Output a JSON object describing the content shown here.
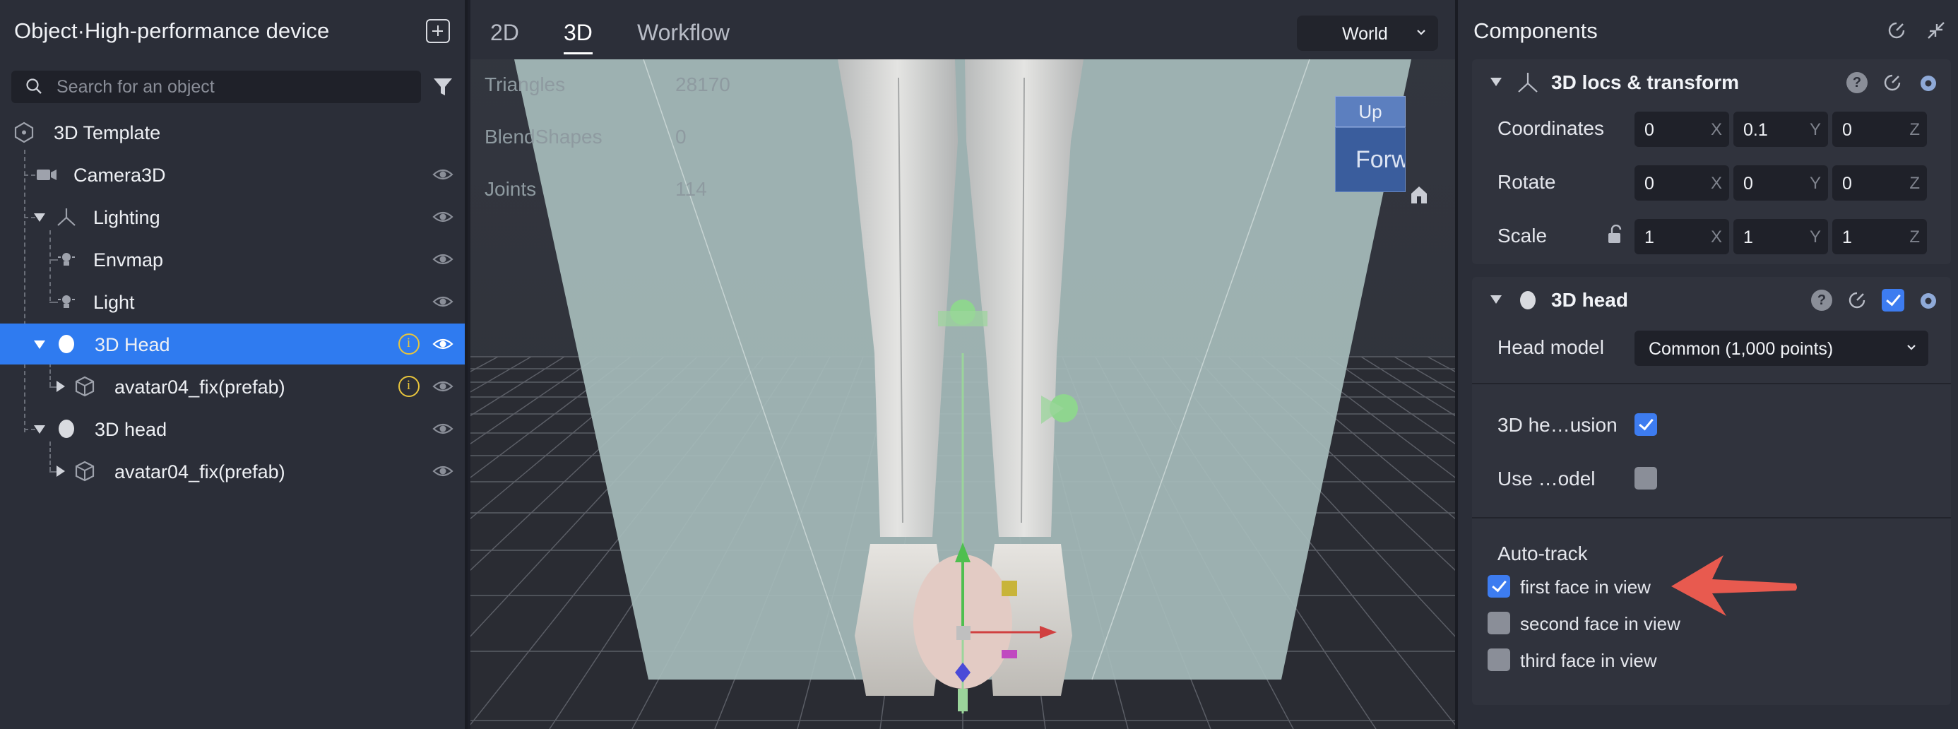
{
  "left_panel": {
    "title": "Object·High-performance device",
    "search_placeholder": "Search for an object",
    "tree": [
      {
        "label": "3D Template"
      },
      {
        "label": "Camera3D"
      },
      {
        "label": "Lighting"
      },
      {
        "label": "Envmap"
      },
      {
        "label": "Light"
      },
      {
        "label": "3D Head"
      },
      {
        "label": "avatar04_fix(prefab)"
      },
      {
        "label": "3D head"
      },
      {
        "label": "avatar04_fix(prefab)"
      }
    ]
  },
  "viewport": {
    "tabs": [
      "2D",
      "3D",
      "Workflow"
    ],
    "active_tab": "3D",
    "space_mode": "World",
    "stats": [
      {
        "label": "Triangles",
        "value": "28170"
      },
      {
        "label": "BlendShapes",
        "value": "0"
      },
      {
        "label": "Joints",
        "value": "114"
      }
    ],
    "view_cube": {
      "up": "Up",
      "forward": "Forwar"
    }
  },
  "right_panel": {
    "title": "Components",
    "transform": {
      "name": "3D locs & transform",
      "help": "?",
      "rows": [
        {
          "label": "Coordinates",
          "values": [
            "0",
            "0.1",
            "0"
          ]
        },
        {
          "label": "Rotate",
          "values": [
            "0",
            "0",
            "0"
          ]
        },
        {
          "label": "Scale",
          "values": [
            "1",
            "1",
            "1"
          ]
        }
      ],
      "axes": [
        "X",
        "Y",
        "Z"
      ]
    },
    "head": {
      "name": "3D head",
      "help": "?",
      "head_model_label": "Head model",
      "head_model_value": "Common (1,000 points)",
      "occlusion_label": "3D he…usion",
      "occlusion_checked": true,
      "use_model_label": "Use …odel",
      "use_model_checked": false,
      "auto_track_label": "Auto-track",
      "faces": [
        {
          "label": "first face in view",
          "checked": true
        },
        {
          "label": "second face in view",
          "checked": false
        },
        {
          "label": "third face in view",
          "checked": false
        }
      ]
    }
  },
  "colors": {
    "accent": "#2f7bf0",
    "warning": "#e7c43c",
    "annotation_arrow": "#e85a4f"
  }
}
